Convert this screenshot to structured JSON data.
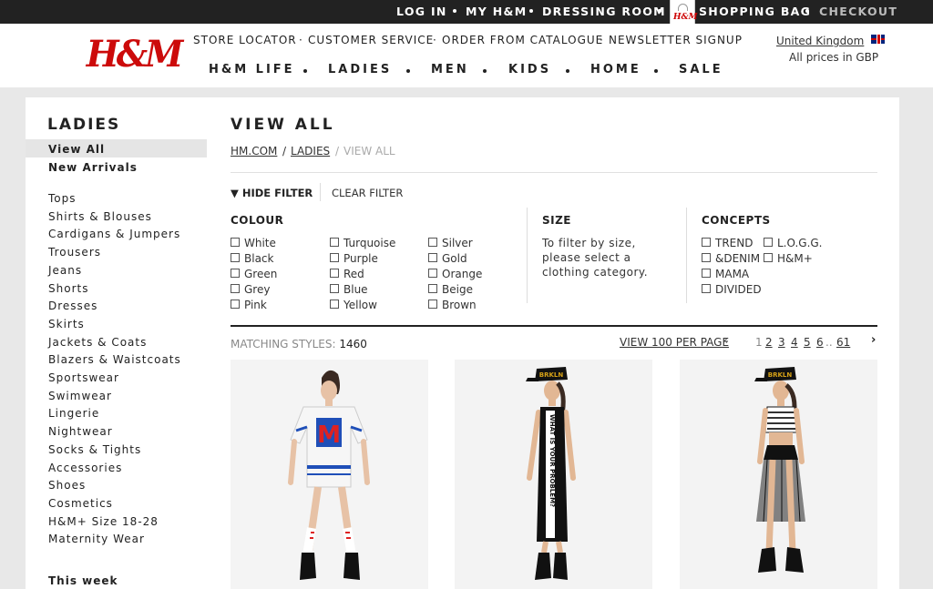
{
  "topbar": {
    "login": "LOG IN",
    "my_hm": "MY H&M",
    "dressing_room": "DRESSING ROOM",
    "bag_logo": "H&M",
    "shopping_bag": "SHOPPING BAG",
    "checkout": "CHECKOUT"
  },
  "header": {
    "brand": "H&M",
    "util_links": [
      "STORE LOCATOR",
      "CUSTOMER SERVICE",
      "ORDER FROM CATALOGUE",
      "NEWSLETTER SIGNUP"
    ],
    "main_nav": [
      "H&M LIFE",
      "LADIES",
      "MEN",
      "KIDS",
      "HOME",
      "SALE"
    ],
    "country": "United Kingdom",
    "prices": "All prices in GBP"
  },
  "sidebar": {
    "title": "LADIES",
    "primary": [
      "View All",
      "New Arrivals"
    ],
    "categories": [
      "Tops",
      "Shirts & Blouses",
      "Cardigans & Jumpers",
      "Trousers",
      "Jeans",
      "Shorts",
      "Dresses",
      "Skirts",
      "Jackets & Coats",
      "Blazers & Waistcoats",
      "Sportswear",
      "Swimwear",
      "Lingerie",
      "Nightwear",
      "Socks & Tights",
      "Accessories",
      "Shoes",
      "Cosmetics",
      "H&M+ Size 18-28",
      "Maternity Wear"
    ],
    "this_week": "This week"
  },
  "main": {
    "title": "VIEW ALL",
    "breadcrumb": [
      "HM.COM",
      "LADIES",
      "VIEW ALL"
    ],
    "breadcrumb_sep": "/",
    "hide_filter": "HIDE FILTER",
    "clear_filter": "CLEAR FILTER",
    "colour": {
      "title": "COLOUR",
      "col1": [
        "White",
        "Black",
        "Green",
        "Grey",
        "Pink"
      ],
      "col2": [
        "Turquoise",
        "Purple",
        "Red",
        "Blue",
        "Yellow"
      ],
      "col3": [
        "Silver",
        "Gold",
        "Orange",
        "Beige",
        "Brown"
      ]
    },
    "size": {
      "title": "SIZE",
      "text": "To filter by size, please select a clothing category."
    },
    "concepts": {
      "title": "CONCEPTS",
      "col1": [
        "TREND",
        "&DENIM",
        "MAMA",
        "DIVIDED"
      ],
      "col2": [
        "L.O.G.G.",
        "H&M+"
      ]
    },
    "matching_label": "MATCHING STYLES:",
    "matching_count": "1460",
    "per_page": "VIEW 100 PER PAGE",
    "pages": [
      "1",
      "2",
      "3",
      "4",
      "5",
      "6",
      "61"
    ],
    "ellipsis": "..",
    "prev": "‹",
    "next": "›",
    "products": [
      {
        "cap_text": "",
        "dress_print": "M",
        "dress_color": "#f4f4f4",
        "accent": "#1f4fb8",
        "stripe": "#d22"
      },
      {
        "cap_text": "BRKLN",
        "dress_print": "WHAT IS YOUR PROBLEM?",
        "dress_color": "#111",
        "accent": "#fff",
        "stripe": "#fff"
      },
      {
        "cap_text": "BRKLN",
        "dress_print": "",
        "dress_color": "#111",
        "accent": "#888",
        "stripe": "#fff"
      }
    ]
  }
}
